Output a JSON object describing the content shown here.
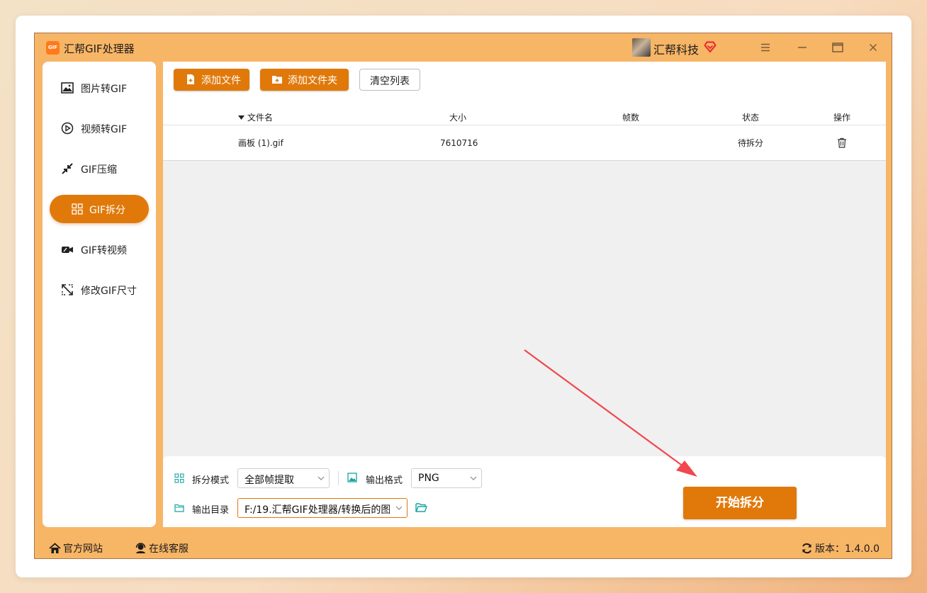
{
  "app": {
    "title": "汇帮GIF处理器",
    "logo_text": "GIF",
    "company": "汇帮科技"
  },
  "sidebar": {
    "items": [
      {
        "label": "图片转GIF",
        "icon": "image-icon",
        "active": false
      },
      {
        "label": "视频转GIF",
        "icon": "play-circle-icon",
        "active": false
      },
      {
        "label": "GIF压缩",
        "icon": "compress-arrows-icon",
        "active": false
      },
      {
        "label": "GIF拆分",
        "icon": "grid-split-icon",
        "active": true
      },
      {
        "label": "GIF转视频",
        "icon": "video-camera-icon",
        "active": false
      },
      {
        "label": "修改GIF尺寸",
        "icon": "resize-icon",
        "active": false
      }
    ]
  },
  "toolbar": {
    "add_file": "添加文件",
    "add_folder": "添加文件夹",
    "clear_list": "清空列表"
  },
  "table": {
    "headers": {
      "filename": "文件名",
      "size": "大小",
      "frames": "帧数",
      "status": "状态",
      "action": "操作"
    },
    "rows": [
      {
        "filename": "画板 (1).gif",
        "size": "7610716",
        "frames": "",
        "status": "待拆分"
      }
    ]
  },
  "options": {
    "split_mode_label": "拆分模式",
    "split_mode_value": "全部帧提取",
    "format_label": "输出格式",
    "format_value": "PNG",
    "output_dir_label": "输出目录",
    "output_dir_value": "F:/19.汇帮GIF处理器/转换后的图"
  },
  "start_button": "开始拆分",
  "statusbar": {
    "website": "官方网站",
    "support": "在线客服",
    "version": "版本：1.4.0.0"
  },
  "colors": {
    "accent": "#e0790a",
    "window_bg": "#f7b566",
    "annotation_arrow": "#f0484e"
  }
}
